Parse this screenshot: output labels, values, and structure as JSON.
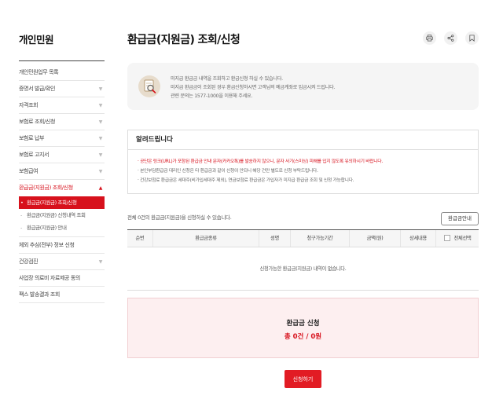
{
  "sidebar": {
    "title": "개인민원",
    "items": [
      {
        "label": "개인민원업무 목록",
        "chevron": false
      },
      {
        "label": "증명서 발급/확인",
        "chevron": true
      },
      {
        "label": "자격조회",
        "chevron": true
      },
      {
        "label": "보험료 조회/신청",
        "chevron": true
      },
      {
        "label": "보험료 납부",
        "chevron": true
      },
      {
        "label": "보험료 고지서",
        "chevron": true
      },
      {
        "label": "보험급여",
        "chevron": true
      }
    ],
    "active_item": {
      "label": "환급금(지원금) 조회/신청",
      "subitems": [
        {
          "label": "환급금(지원금) 조회/신청",
          "selected": true
        },
        {
          "label": "환급금(지원금) 신청내역 조회",
          "selected": false
        },
        {
          "label": "환급금(지원금) 안내",
          "selected": false
        }
      ]
    },
    "items_after": [
      {
        "label": "체외 추심(전부) 정보 신청",
        "chevron": false
      },
      {
        "label": "건강검진",
        "chevron": true
      },
      {
        "label": "사업장 의료비 자료제공 동의",
        "chevron": false
      },
      {
        "label": "팩스 발송결과 조회",
        "chevron": false
      }
    ]
  },
  "header": {
    "title": "환급금(지원금) 조회/신청",
    "tools": [
      "print-icon",
      "share-icon",
      "bookmark-icon"
    ]
  },
  "info": {
    "icon": "search-document-icon",
    "line1": "미지급 환급금 내역을 조회하고 환급신청 하실 수 있습니다.",
    "line2": "미지급 환급금이 조회된 경우 환급신청하시면 고객님의 예금계좌로 입금시켜 드립니다.",
    "line3": "관련 문의는 1577-1000을 이용해 주세요."
  },
  "notice": {
    "heading": "알려드립니다",
    "items": [
      {
        "text": "공단은 링크(URL)가 포함된 환급금 안내 문자(카카오톡)를 발송하지 않으니, 문자 사기(스미싱) 피해를 입지 않도록 유의하시기 바랍니다.",
        "highlight": true
      },
      {
        "text": "본인부담환급금 대리인 신청은 타 환급금과 같이 신청이 안되니 해당 건만 별도로 신청 부탁드립니다.",
        "highlight": false
      },
      {
        "text": "건강보험료 환급금은 세대주(비가입세대주 제외), 연금보험료 환급금은 가입자가 미지급 환급금 조회 및 신청 가능합니다.",
        "highlight": false
      }
    ]
  },
  "list": {
    "count_text": "전체 0건의 환급금(지원금)을 신청하실 수 있습니다.",
    "guide_button": "환급금안내",
    "columns": [
      "순번",
      "환급금종류",
      "성명",
      "청구가능기간",
      "금액(원)",
      "상세내용",
      "전체선택"
    ],
    "empty_text": "신청가능한 환급금(지원금) 내역이 없습니다."
  },
  "summary": {
    "label": "환급금 신청",
    "total": "총 0건 / 0원"
  },
  "apply_button": "신청하기",
  "colors": {
    "accent": "#d7111c",
    "summary_bg": "#fdeff0",
    "info_bg": "#f5f5f5"
  }
}
